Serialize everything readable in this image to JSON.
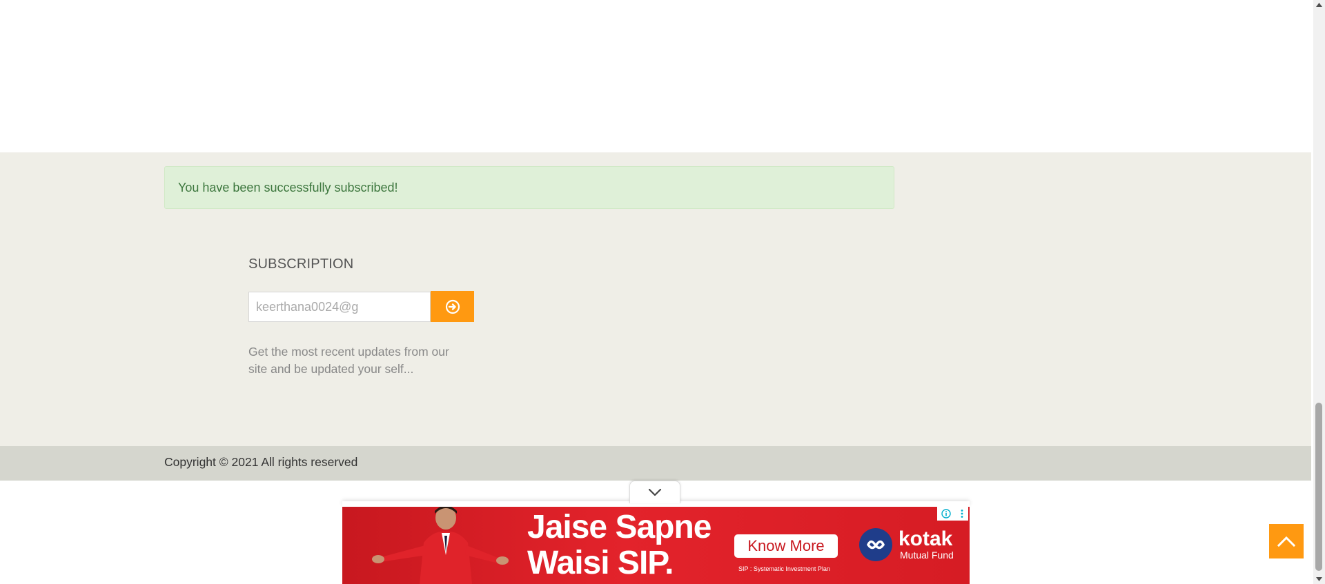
{
  "alert": {
    "message": "You have been successfully subscribed!"
  },
  "subscription": {
    "heading": "SUBSCRIPTION",
    "email_value": "keerthana0024@g",
    "submit_icon": "arrow-circle-right-icon",
    "description": "Get the most recent updates from our site and be updated your self..."
  },
  "footer": {
    "copyright": "Copyright © 2021 All rights reserved"
  },
  "ad": {
    "headline_line1": "Jaise Sapne",
    "headline_line2": "Waisi SIP.",
    "cta_label": "Know More",
    "brand_name": "kotak",
    "brand_sub": "Mutual Fund",
    "fine_print": "SIP : Systematic Investment Plan"
  },
  "colors": {
    "accent": "#ff9911",
    "footer_bg": "#efeee7",
    "copyright_bg": "#d5d6ce",
    "success_bg": "#dff0d8",
    "success_text": "#3c763d",
    "ad_red": "#e3232b"
  }
}
